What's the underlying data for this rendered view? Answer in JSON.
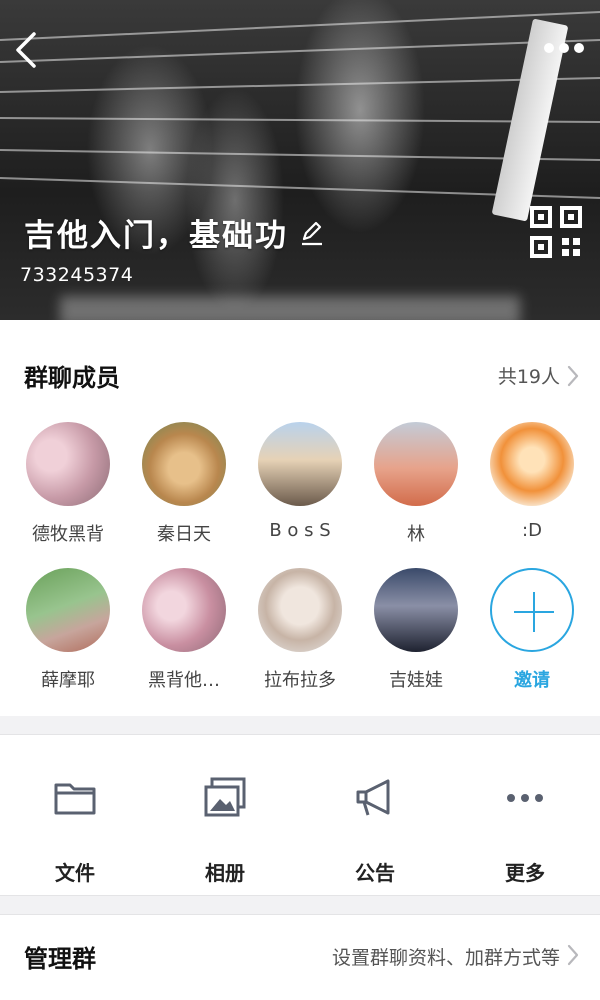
{
  "header": {
    "group_name": "吉他入门，基础功",
    "group_id": "733245374",
    "icons": {
      "back": "chevron-left-icon",
      "more": "more-horizontal-icon",
      "edit": "pencil-icon",
      "qr": "qr-code-icon"
    }
  },
  "members_section": {
    "title": "群聊成员",
    "count_label": "共19人",
    "members": [
      {
        "name": "德牧黑背"
      },
      {
        "name": "秦日天"
      },
      {
        "name": "B o s  S"
      },
      {
        "name": "林"
      },
      {
        "name": ":D"
      },
      {
        "name": "薛摩耶"
      },
      {
        "name": "黑背他…"
      },
      {
        "name": "拉布拉多"
      },
      {
        "name": "吉娃娃"
      }
    ],
    "invite_label": "邀请"
  },
  "actions": [
    {
      "label": "文件",
      "icon": "folder-icon"
    },
    {
      "label": "相册",
      "icon": "photo-album-icon"
    },
    {
      "label": "公告",
      "icon": "megaphone-icon"
    },
    {
      "label": "更多",
      "icon": "more-dots-icon"
    }
  ],
  "manage": {
    "title": "管理群",
    "description": "设置群聊资料、加群方式等"
  },
  "colors": {
    "accent": "#2aa6e0",
    "icon_gray": "#5a6170",
    "background": "#f2f2f4"
  }
}
